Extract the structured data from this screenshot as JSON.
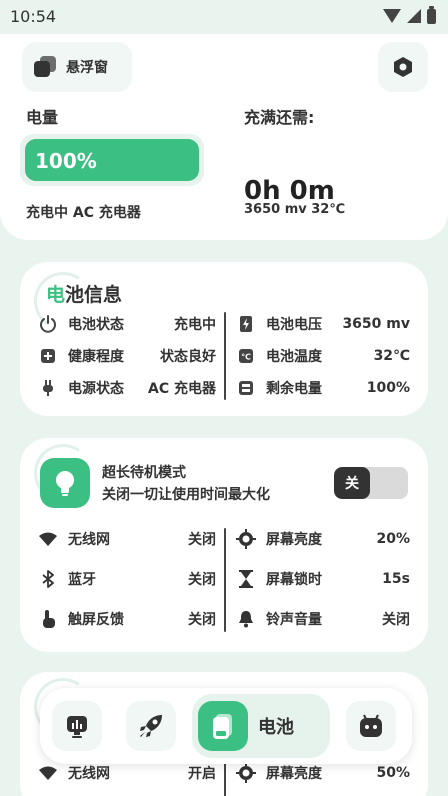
{
  "status_bar": {
    "time": "10:54"
  },
  "header": {
    "float_window_label": "悬浮窗",
    "level_label": "电量",
    "level_percent": "100%",
    "level_fraction": 1.0,
    "remaining_label": "充满还需:",
    "remaining_value": "0h 0m",
    "charge_status": "充电中  AC 充电器",
    "voltage_temp": "3650 mv   32℃"
  },
  "battery_info": {
    "title_highlight": "电",
    "title_rest": "池信息",
    "left": [
      {
        "icon": "power-icon",
        "label": "电池状态",
        "value": "充电中"
      },
      {
        "icon": "health-plus-icon",
        "label": "健康程度",
        "value": "状态良好"
      },
      {
        "icon": "plug-icon",
        "label": "电源状态",
        "value": "AC 充电器"
      }
    ],
    "right": [
      {
        "icon": "voltage-bolt-icon",
        "label": "电池电压",
        "value": "3650 mv"
      },
      {
        "icon": "temperature-icon",
        "label": "电池温度",
        "value": "32℃"
      },
      {
        "icon": "battery-remaining-icon",
        "label": "剩余电量",
        "value": "100%"
      }
    ]
  },
  "standby_mode": {
    "title": "超长待机模式",
    "subtitle": "关闭一切让使用时间最大化",
    "toggle_label": "关",
    "left": [
      {
        "icon": "wifi-icon",
        "label": "无线网",
        "value": "关闭"
      },
      {
        "icon": "bluetooth-icon",
        "label": "蓝牙",
        "value": "关闭"
      },
      {
        "icon": "touch-feedback-icon",
        "label": "触屏反馈",
        "value": "关闭"
      }
    ],
    "right": [
      {
        "icon": "brightness-icon",
        "label": "屏幕亮度",
        "value": "20%"
      },
      {
        "icon": "hourglass-icon",
        "label": "屏幕锁时",
        "value": "15s"
      },
      {
        "icon": "bell-icon",
        "label": "铃声音量",
        "value": "关闭"
      }
    ]
  },
  "third_card": {
    "left": {
      "icon": "wifi-icon",
      "label": "无线网",
      "value": "开启"
    },
    "right": {
      "icon": "brightness-icon",
      "label": "屏幕亮度",
      "value": "50%"
    }
  },
  "bottom_nav": {
    "items": [
      {
        "icon": "stats-icon"
      },
      {
        "icon": "rocket-icon"
      },
      {
        "icon": "battery-nav-icon",
        "label": "电池",
        "active": true
      },
      {
        "icon": "android-icon"
      }
    ]
  },
  "colors": {
    "accent": "#3cbf82",
    "background": "#e9f4ef"
  }
}
